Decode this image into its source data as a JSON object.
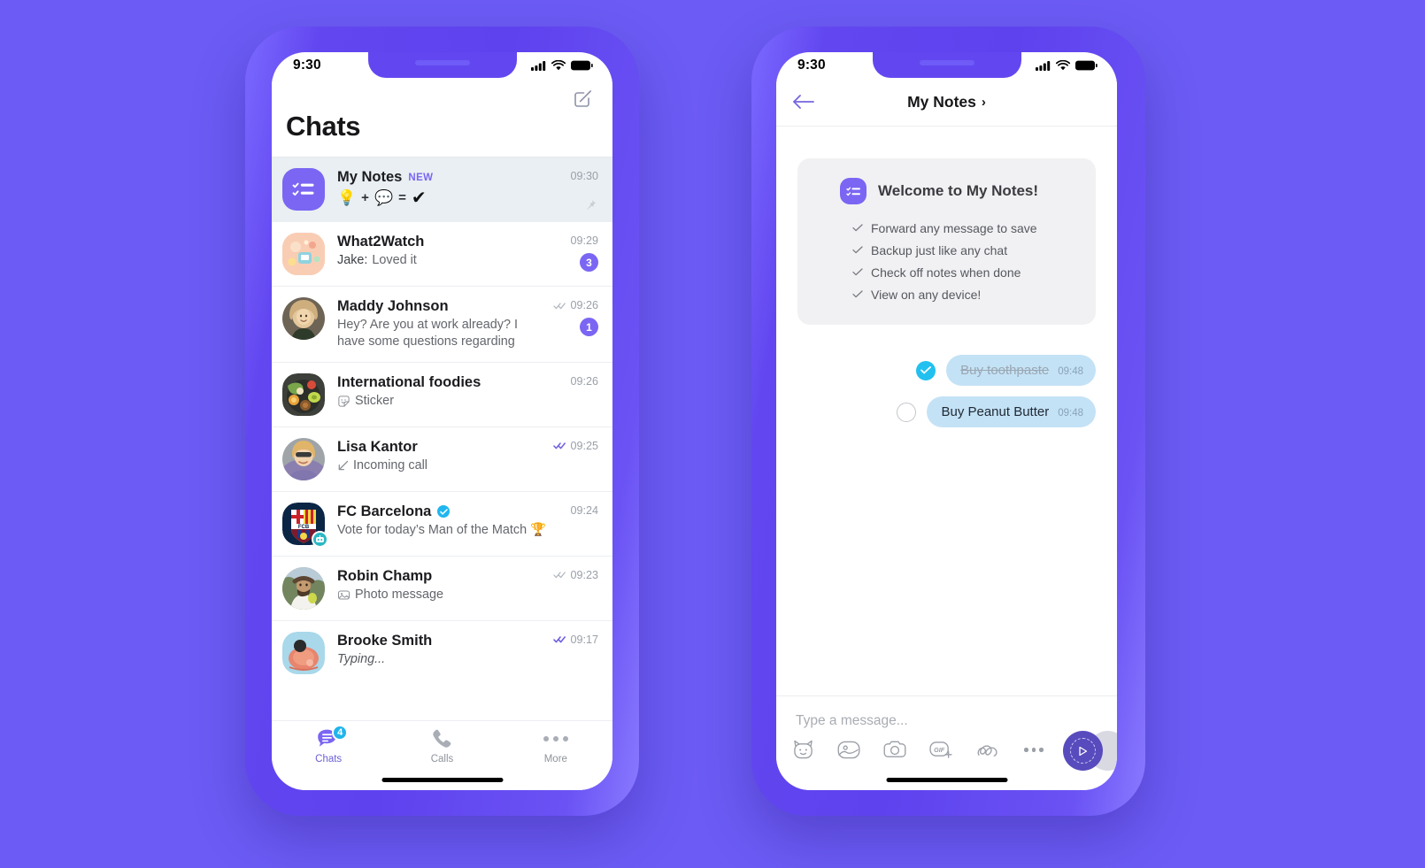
{
  "theme": {
    "background": "#6c5cf5",
    "phone_frame": "#6247f0",
    "brand_purple": "#7a66f3",
    "accent_cyan": "#21c0ef",
    "bubble_blue": "#c4e2f6",
    "send_button": "#584bbd"
  },
  "left_phone": {
    "status_bar": {
      "time": "9:30",
      "signal": "signal-bars-icon",
      "wifi": "wifi-icon",
      "battery": "battery-full-icon"
    },
    "header": {
      "title": "Chats",
      "compose": "compose-icon"
    },
    "chats": [
      {
        "name": "My Notes",
        "badge": "NEW",
        "time": "09:30",
        "pinned": true,
        "emoji_preview": [
          "💡",
          "+",
          "💬",
          "=",
          "✔"
        ],
        "avatar_kind": "notes-icon"
      },
      {
        "name": "What2Watch",
        "preview_sender": "Jake:",
        "preview": "Loved it",
        "time": "09:29",
        "unread": "3",
        "avatar_kind": "what2watch-art"
      },
      {
        "name": "Maddy Johnson",
        "preview": "Hey? Are you at work already? I have some questions regarding",
        "time": "09:26",
        "unread": "1",
        "ticks": "double-check-grey",
        "avatar_kind": "photo-maddy"
      },
      {
        "name": "International foodies",
        "preview": "Sticker",
        "preview_icon": "sticker-icon",
        "time": "09:26",
        "avatar_kind": "photo-food"
      },
      {
        "name": "Lisa Kantor",
        "preview": "Incoming call",
        "preview_icon": "incoming-call-icon",
        "time": "09:25",
        "ticks": "double-check-purple",
        "avatar_kind": "photo-lisa"
      },
      {
        "name": "FC Barcelona",
        "verified": true,
        "bot": true,
        "preview": "Vote for today’s Man of the Match 🏆",
        "time": "09:24",
        "avatar_kind": "fcb-crest"
      },
      {
        "name": "Robin Champ",
        "preview": "Photo message",
        "preview_icon": "photo-icon",
        "time": "09:23",
        "ticks": "double-check-grey",
        "avatar_kind": "photo-robin"
      },
      {
        "name": "Brooke Smith",
        "preview": "Typing...",
        "italic": true,
        "time": "09:17",
        "ticks": "double-check-purple",
        "avatar_kind": "photo-brooke"
      }
    ],
    "tabs": [
      {
        "label": "Chats",
        "icon": "chats-icon",
        "badge": "4",
        "active": true
      },
      {
        "label": "Calls",
        "icon": "phone-icon",
        "active": false
      },
      {
        "label": "More",
        "icon": "more-dots-icon",
        "active": false
      }
    ]
  },
  "right_phone": {
    "status_bar": {
      "time": "9:30",
      "signal": "signal-bars-icon",
      "wifi": "wifi-icon",
      "battery": "battery-full-icon"
    },
    "header": {
      "back": "back-arrow-icon",
      "title": "My Notes",
      "chevron": "›"
    },
    "welcome_card": {
      "icon": "notes-icon",
      "title": "Welcome to My Notes!",
      "items": [
        "Forward any message to save",
        "Backup just like any chat",
        "Check off notes when done",
        "View on any device!"
      ]
    },
    "messages": [
      {
        "text": "Buy toothpaste",
        "time": "09:48",
        "done": true
      },
      {
        "text": "Buy Peanut Butter",
        "time": "09:48",
        "done": false
      }
    ],
    "composer": {
      "placeholder": "Type a message...",
      "icons": [
        "sticker-cat-icon",
        "gallery-icon",
        "camera-icon",
        "gif-plus-icon",
        "doodle-icon",
        "more-dots-icon"
      ],
      "send": "send-play-icon"
    }
  }
}
